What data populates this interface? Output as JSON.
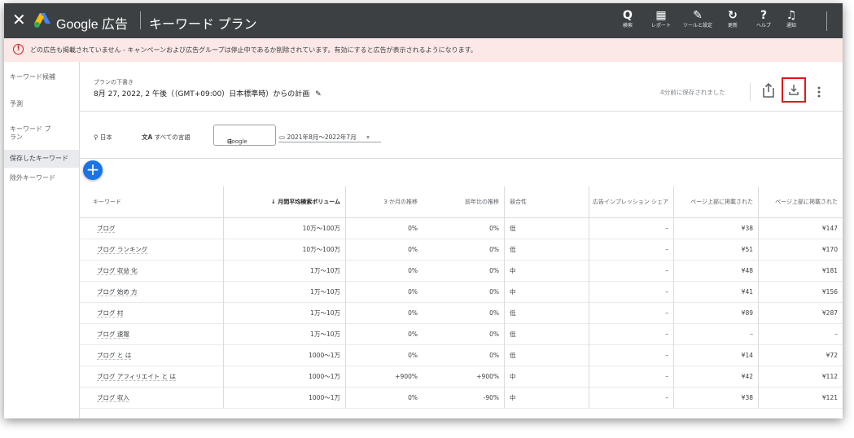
{
  "topbar": {
    "brand": "Google 広告",
    "title": "キーワード プラン",
    "actions": [
      {
        "icon": "search-icon",
        "glyph": "Q",
        "label": "検索"
      },
      {
        "icon": "report-icon",
        "glyph": "▦",
        "label": "レポート"
      },
      {
        "icon": "tools-icon",
        "glyph": "✎",
        "label": "ツールと設定"
      },
      {
        "icon": "refresh-icon",
        "glyph": "↻",
        "label": "更新"
      },
      {
        "icon": "help-icon",
        "glyph": "?",
        "label": "ヘルプ"
      },
      {
        "icon": "bell-icon",
        "glyph": "♫",
        "label": "通知"
      }
    ]
  },
  "warning": {
    "text": "どの広告も掲載されていません - キャンペーンおよび広告グループは停止中であるか削除されています。有効にすると広告が表示されるようになります。"
  },
  "sidebar": {
    "items": [
      {
        "label": "キーワード候補"
      },
      {
        "label": "予測"
      },
      {
        "label": "キーワード プラン"
      },
      {
        "label": "保存したキーワード"
      },
      {
        "label": "除外キーワード"
      }
    ]
  },
  "plan": {
    "label": "プランの下書き",
    "title": "8月 27, 2022, 2 午後（（GMT+09:00）日本標準時）からの計画",
    "saved": "4分前に保存されました"
  },
  "filters": {
    "location": "日本",
    "language": "すべての言語",
    "network": "Google",
    "date_range": "2021年8月～2022年7月"
  },
  "table": {
    "headers": {
      "keyword": "キーワード",
      "volume": "↓ 月間平均検索ボリューム",
      "three_month": "3 か月の推移",
      "yoy": "前年比の推移",
      "competition": "競合性",
      "impression_share": "広告インプレッション シェア",
      "top_bid_low": "ページ上部に掲載された",
      "top_bid_high": "ページ上部に掲載された"
    },
    "rows": [
      {
        "keyword": "ブログ",
        "volume": "10万～100万",
        "three_month": "0%",
        "yoy": "0%",
        "competition": "低",
        "share": "–",
        "bid_low": "¥38",
        "bid_high": "¥147"
      },
      {
        "keyword": "ブログ ランキング",
        "volume": "10万～100万",
        "three_month": "0%",
        "yoy": "0%",
        "competition": "低",
        "share": "–",
        "bid_low": "¥51",
        "bid_high": "¥170"
      },
      {
        "keyword": "ブログ 収益 化",
        "volume": "1万～10万",
        "three_month": "0%",
        "yoy": "0%",
        "competition": "中",
        "share": "–",
        "bid_low": "¥48",
        "bid_high": "¥181"
      },
      {
        "keyword": "ブログ 始め 方",
        "volume": "1万～10万",
        "three_month": "0%",
        "yoy": "0%",
        "competition": "中",
        "share": "–",
        "bid_low": "¥41",
        "bid_high": "¥156"
      },
      {
        "keyword": "ブログ 村",
        "volume": "1万～10万",
        "three_month": "0%",
        "yoy": "0%",
        "competition": "低",
        "share": "–",
        "bid_low": "¥89",
        "bid_high": "¥287"
      },
      {
        "keyword": "ブログ 速報",
        "volume": "1万～10万",
        "three_month": "0%",
        "yoy": "0%",
        "competition": "低",
        "share": "–",
        "bid_low": "–",
        "bid_high": "–"
      },
      {
        "keyword": "ブログ と は",
        "volume": "1000～1万",
        "three_month": "0%",
        "yoy": "0%",
        "competition": "低",
        "share": "–",
        "bid_low": "¥14",
        "bid_high": "¥72"
      },
      {
        "keyword": "ブログ アフィリエイト と は",
        "volume": "1000～1万",
        "three_month": "+900%",
        "yoy": "+900%",
        "competition": "中",
        "share": "–",
        "bid_low": "¥42",
        "bid_high": "¥112"
      },
      {
        "keyword": "ブログ 収入",
        "volume": "1000～1万",
        "three_month": "0%",
        "yoy": "-90%",
        "competition": "中",
        "share": "–",
        "bid_low": "¥38",
        "bid_high": "¥121"
      }
    ]
  },
  "colors": {
    "topbar": "#3c4043",
    "warning_bg": "#fce8e6",
    "accent": "#1a73e8",
    "highlight": "#e2171d"
  }
}
